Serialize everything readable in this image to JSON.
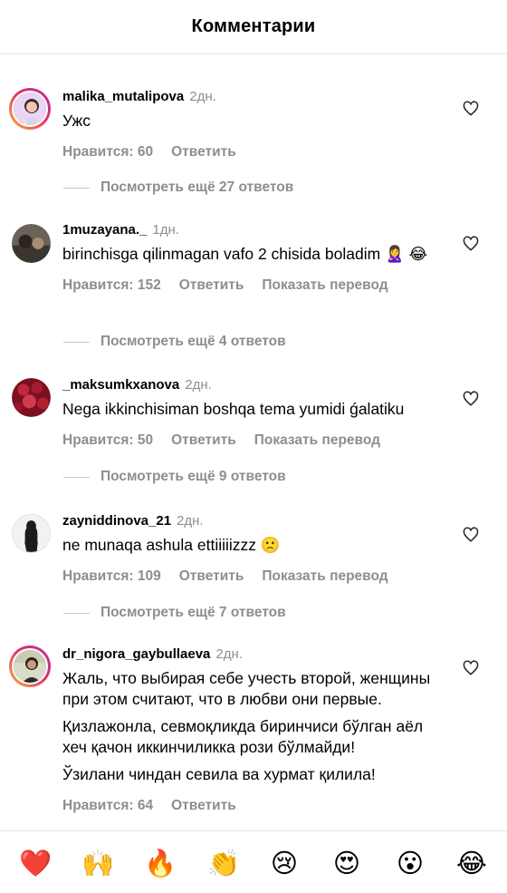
{
  "header": {
    "title": "Комментарии"
  },
  "comments": [
    {
      "username": "malika_mutalipova",
      "time": "2дн.",
      "text": [
        "Ужс"
      ],
      "likes": "Нравится: 60",
      "reply": "Ответить",
      "translate": "",
      "replies": "Посмотреть ещё 27 ответов"
    },
    {
      "username": "1muzayana._",
      "time": "1дн.",
      "text": [
        "birinchisga qilinmagan vafo 2 chisida boladim 🙎‍♀️ 😂"
      ],
      "likes": "Нравится: 152",
      "reply": "Ответить",
      "translate": "Показать перевод",
      "replies": "Посмотреть ещё 4 ответов"
    },
    {
      "username": "_maksumkxanova",
      "time": "2дн.",
      "text": [
        "Nega ikkinchisiman boshqa tema yumidi ǵalatiku"
      ],
      "likes": "Нравится: 50",
      "reply": "Ответить",
      "translate": "Показать перевод",
      "replies": "Посмотреть ещё 9 ответов"
    },
    {
      "username": "zayniddinova_21",
      "time": "2дн.",
      "text": [
        "ne munaqa ashula ettiiiiizzz 🙁"
      ],
      "likes": "Нравится: 109",
      "reply": "Ответить",
      "translate": "Показать перевод",
      "replies": "Посмотреть ещё 7 ответов"
    },
    {
      "username": "dr_nigora_gaybullaeva",
      "time": "2дн.",
      "text": [
        "Жаль, что выбирая себе учесть второй, женщины при этом считают, что в любви они первые.",
        "Қизлажонла, севмоқликда биринчиси бўлган аёл хеч қачон иккинчиликка рози бўлмайди!",
        "Ўзилани чиндан севила ва хурмат қилила!"
      ],
      "likes": "Нравится: 64",
      "reply": "Ответить",
      "translate": "",
      "replies": ""
    }
  ],
  "emoji_bar": [
    "❤️",
    "🙌",
    "🔥",
    "👏",
    "😢",
    "😍",
    "😮",
    "😂"
  ],
  "colors": {
    "secondary_text": "#8e8e8e",
    "divider": "#e6e6e6",
    "ring_start": "#fbb03b",
    "ring_end": "#b4339c"
  }
}
